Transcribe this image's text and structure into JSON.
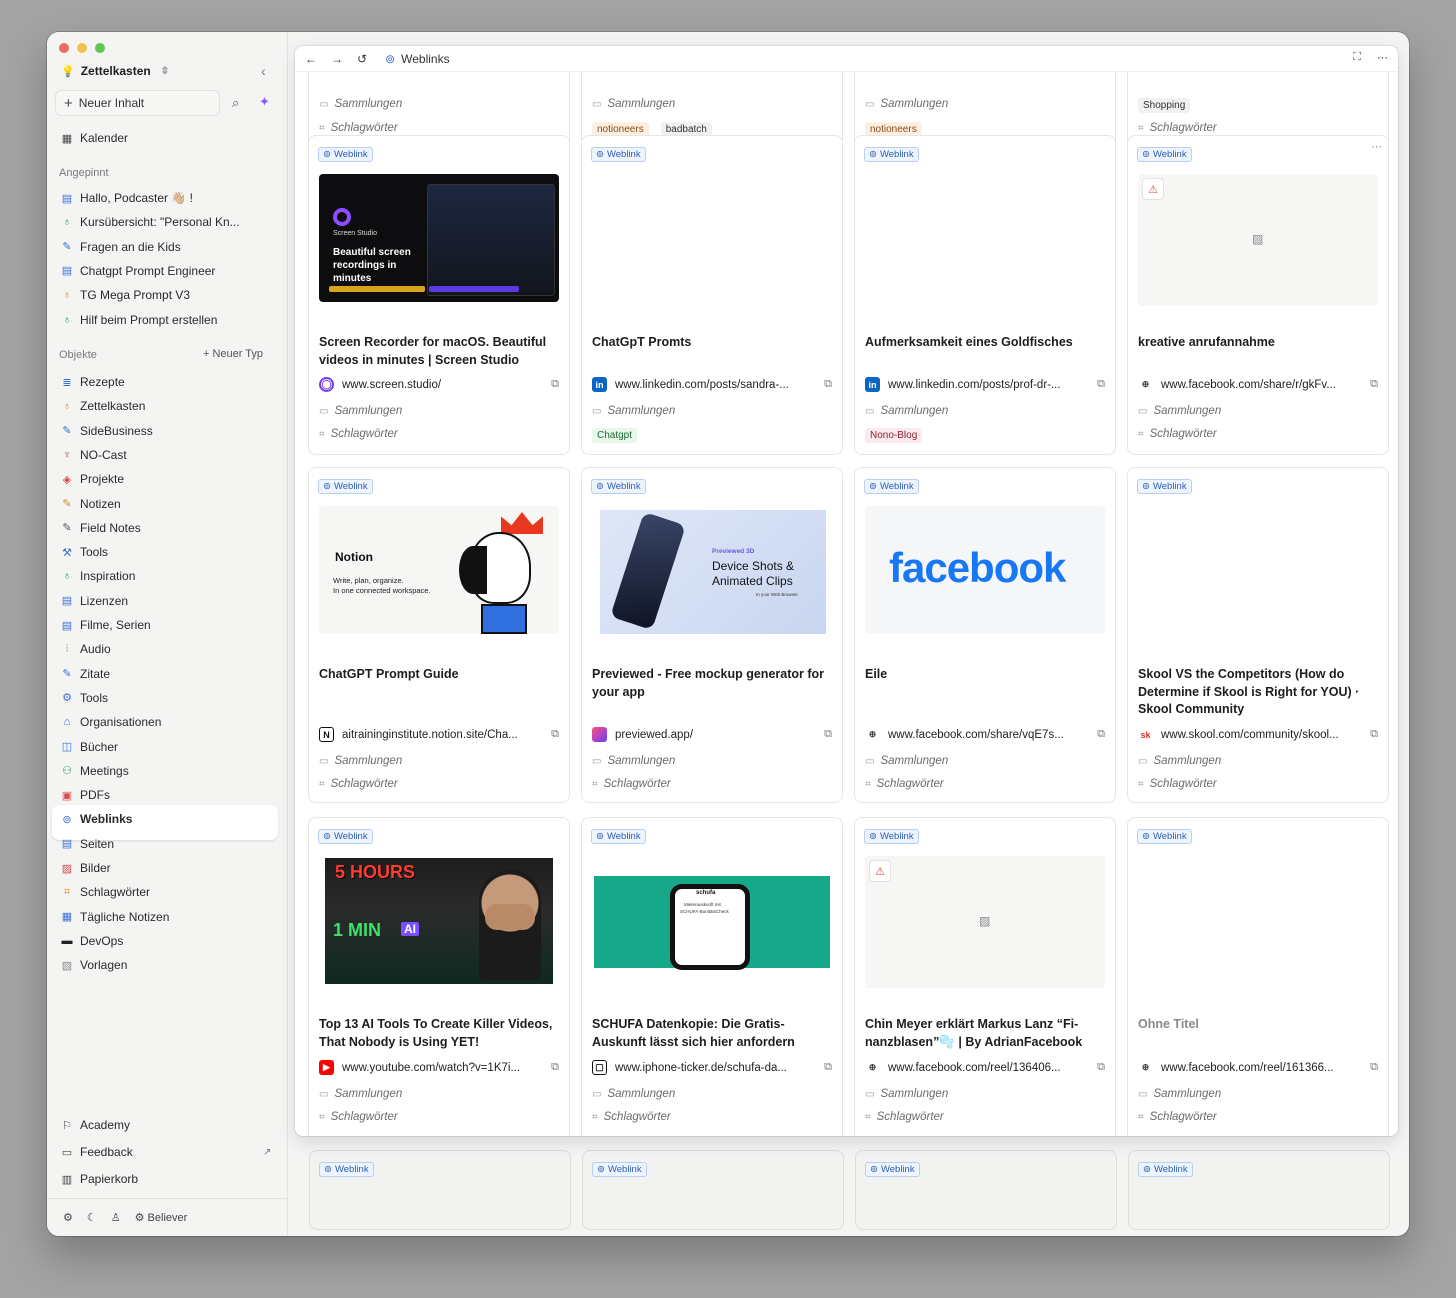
{
  "sidebar": {
    "workspace": "Zettelkasten",
    "new_content": "Neuer Inhalt",
    "calendar": "Kalender",
    "pinned_header": "Angepinnt",
    "pinned": [
      {
        "label": "Hallo, Podcaster 👋🏼 !",
        "icon": "page-icon",
        "color": "#3b6fd8"
      },
      {
        "label": "Kursübersicht: \"Personal Kn...",
        "icon": "bulb-icon",
        "color": "#2f9e5a"
      },
      {
        "label": "Fragen an die Kids",
        "icon": "pencil-icon",
        "color": "#3b6fd8"
      },
      {
        "label": "Chatgpt Prompt Engineer",
        "icon": "page-icon",
        "color": "#3b6fd8"
      },
      {
        "label": "TG Mega Prompt V3",
        "icon": "bulb-icon",
        "color": "#d98a1c"
      },
      {
        "label": "Hilf beim Prompt erstellen",
        "icon": "bulb-icon",
        "color": "#2f9e5a"
      }
    ],
    "objects_header": "Objekte",
    "new_type": "+ Neuer Typ",
    "objects": [
      {
        "label": "Rezepte",
        "icon": "stack-icon",
        "color": "#3b6fd8"
      },
      {
        "label": "Zettelkasten",
        "icon": "bulb-icon",
        "color": "#d98a1c"
      },
      {
        "label": "SideBusiness",
        "icon": "pencil-icon",
        "color": "#3b6fd8"
      },
      {
        "label": "NO-Cast",
        "icon": "mic-icon",
        "color": "#d94848"
      },
      {
        "label": "Projekte",
        "icon": "cube-icon",
        "color": "#d94848"
      },
      {
        "label": "Notizen",
        "icon": "pencil-icon",
        "color": "#d98a1c"
      },
      {
        "label": "Field Notes",
        "icon": "pencil-icon",
        "color": "#555555"
      },
      {
        "label": "Tools",
        "icon": "wrench-icon",
        "color": "#3b6fd8"
      },
      {
        "label": "Inspiration",
        "icon": "bulb-icon",
        "color": "#2f9e5a"
      },
      {
        "label": "Lizenzen",
        "icon": "page-icon",
        "color": "#3b6fd8"
      },
      {
        "label": "Filme, Serien",
        "icon": "page-icon",
        "color": "#3b6fd8"
      },
      {
        "label": "Audio",
        "icon": "wave-icon",
        "color": "#d94848"
      },
      {
        "label": "Zitate",
        "icon": "pencil-icon",
        "color": "#3b6fd8"
      },
      {
        "label": "Tools",
        "icon": "gear-icon",
        "color": "#3b6fd8"
      },
      {
        "label": "Organisationen",
        "icon": "building-icon",
        "color": "#3b6fd8"
      },
      {
        "label": "Bücher",
        "icon": "book-icon",
        "color": "#3b6fd8"
      },
      {
        "label": "Meetings",
        "icon": "people-icon",
        "color": "#2f9e5a"
      },
      {
        "label": "PDFs",
        "icon": "pdf-icon",
        "color": "#d94848"
      },
      {
        "label": "Weblinks",
        "icon": "link-icon",
        "color": "#3b6fd8"
      },
      {
        "label": "Seiten",
        "icon": "page-icon",
        "color": "#3b6fd8"
      },
      {
        "label": "Bilder",
        "icon": "image-icon",
        "color": "#d94848"
      },
      {
        "label": "Schlagwörter",
        "icon": "tag-icon",
        "color": "#d98a1c"
      },
      {
        "label": "Tägliche Notizen",
        "icon": "calendar-icon",
        "color": "#3b6fd8"
      },
      {
        "label": "DevOps",
        "icon": "monitor-icon",
        "color": "#222222"
      },
      {
        "label": "Vorlagen",
        "icon": "template-icon",
        "color": "#888888"
      }
    ],
    "bottom": [
      {
        "label": "Academy",
        "icon": "academy-icon"
      },
      {
        "label": "Feedback",
        "icon": "feedback-icon"
      },
      {
        "label": "Papierkorb",
        "icon": "trash-icon"
      }
    ],
    "footer_user": "Believer"
  },
  "topbar": {
    "title": "Weblinks"
  },
  "labels": {
    "badge": "Weblink",
    "collections": "Sammlungen",
    "tags": "Schlagwörter"
  },
  "top_partial": [
    {
      "tags": []
    },
    {
      "tags": [
        {
          "t": "notioneers",
          "c": "orange"
        },
        {
          "t": "badbatch",
          "c": "plain"
        }
      ]
    },
    {
      "tags": [
        {
          "t": "notioneers",
          "c": "orange"
        }
      ]
    },
    {
      "collection_tag": "Shopping",
      "tags": []
    }
  ],
  "cards": [
    {
      "title": "Screen Recorder for macOS. Beautiful videos in minutes | Screen Studio",
      "domain": "www.screen.studio",
      "path": "/",
      "favicon": "screenstudio",
      "thumb": "screenstudio",
      "thumb_text": [
        "Screen Studio",
        "Beautiful screen recordings in minutes"
      ],
      "tags": []
    },
    {
      "title": "ChatGpT Promts",
      "domain": "www.linkedin.com",
      "path": "/posts/sandra-...",
      "favicon": "linkedin",
      "thumb": "none",
      "tags": [
        {
          "t": "Chatgpt",
          "c": "green"
        }
      ]
    },
    {
      "title": "Aufmerksamkeit eines Goldfisches",
      "domain": "www.linkedin.com",
      "path": "/posts/prof-dr-...",
      "favicon": "linkedin",
      "thumb": "none",
      "tags": [
        {
          "t": "Nono-Blog",
          "c": "pink"
        }
      ]
    },
    {
      "title": "kreative anrufannahme",
      "domain": "www.facebook.com",
      "path": "/share/r/gkFv...",
      "favicon": "globe",
      "thumb": "broken",
      "tags": []
    },
    {
      "title": "ChatGPT Prompt Guide",
      "domain": "aitraininginstitute.notion.site",
      "path": "/Cha...",
      "favicon": "notion",
      "thumb": "notion",
      "thumb_text": [
        "Notion",
        "Write, plan, organize.",
        "In one connected workspace."
      ],
      "tags": []
    },
    {
      "title": "Previewed - Free mockup generator for your app",
      "domain": "previewed.app",
      "path": "/",
      "favicon": "previewed",
      "thumb": "previewed",
      "thumb_text": [
        "Previewed 3D",
        "Device Shots &",
        "Animated Clips",
        "In your Web Browser."
      ],
      "tags": []
    },
    {
      "title": "Eile",
      "domain": "www.facebook.com",
      "path": "/share/vqE7s...",
      "favicon": "globe",
      "thumb": "facebook",
      "thumb_text": [
        "facebook"
      ],
      "tags": []
    },
    {
      "title": "Skool VS the Competitors (How do Determine if Skool is Right for YOU) · Skool Community",
      "domain": "www.skool.com",
      "path": "/community/skool...",
      "favicon": "skool",
      "thumb": "none",
      "tags": []
    },
    {
      "title": "Top 13 AI Tools To Create Killer Videos, That Nobody is Using YET!",
      "domain": "www.youtube.com",
      "path": "/watch?v=1K7i...",
      "favicon": "youtube",
      "thumb": "youtube",
      "thumb_text": [
        "5 HOURS",
        "1 MIN",
        "AI"
      ],
      "tags": []
    },
    {
      "title": "SCHUFA Datenkopie: Die Gratis-Auskunft lässt sich hier anfordern",
      "domain": "www.iphone-ticker.de",
      "path": "/schufa-da...",
      "favicon": "iphoneticker",
      "thumb": "schufa",
      "thumb_text": [
        "schufa",
        "Mieterauskunft mit",
        "SCHUFA-BonitätsCheck"
      ],
      "tags": []
    },
    {
      "title": "Chin Meyer erklärt Markus Lanz “Fi-nanzblasen”🫧 | By AdrianFacebook",
      "domain": "www.facebook.com",
      "path": "/reel/136406...",
      "favicon": "globe",
      "thumb": "broken",
      "tags": []
    },
    {
      "title": "Ohne Titel",
      "domain": "www.facebook.com",
      "path": "/reel/161366...",
      "favicon": "globe",
      "thumb": "none",
      "muted": true,
      "tags": []
    }
  ]
}
